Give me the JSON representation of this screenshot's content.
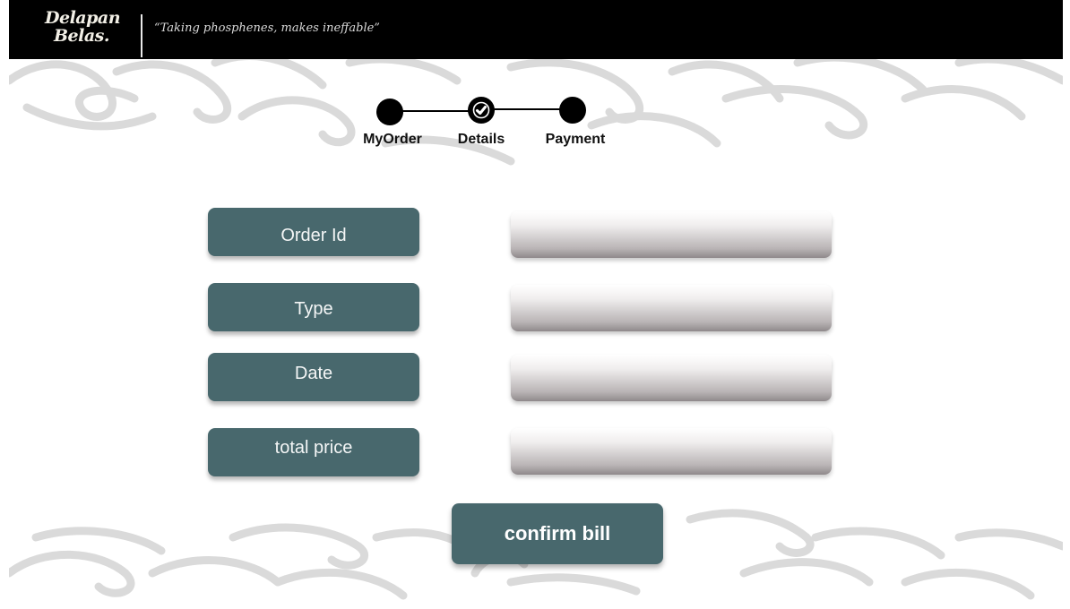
{
  "header": {
    "logo_line1": "Delapan",
    "logo_line2": "Belas.",
    "tagline": "“Taking phosphenes, makes ineffable”"
  },
  "stepper": {
    "steps": [
      {
        "label": "MyOrder",
        "completed": false
      },
      {
        "label": "Details",
        "completed": true
      },
      {
        "label": "Payment",
        "completed": false
      }
    ]
  },
  "form": {
    "fields": [
      {
        "label": "Order Id",
        "value": ""
      },
      {
        "label": "Type",
        "value": ""
      },
      {
        "label": "Date",
        "value": ""
      },
      {
        "label": "total price",
        "value": ""
      }
    ]
  },
  "actions": {
    "confirm_label": "confirm bill"
  },
  "colors": {
    "header_bg": "#000000",
    "accent": "#48686d",
    "ornament": "#cfcfcf"
  },
  "icons": {
    "logo": "delapan-belas-logo",
    "step_check": "check-icon",
    "background": "cloud-ornament-pattern"
  }
}
